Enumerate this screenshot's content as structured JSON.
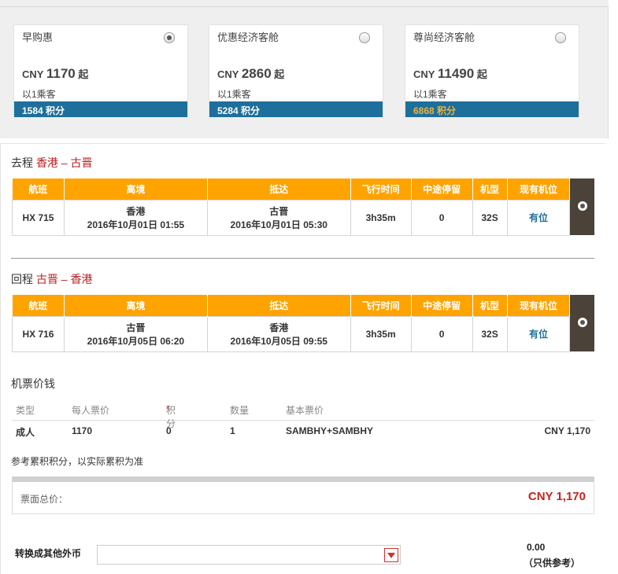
{
  "fares": [
    {
      "name": "早购惠",
      "currency": "CNY",
      "amount": "1170",
      "suffix": "起",
      "pax": "以1乘客",
      "points": "1584 积分",
      "selected": true
    },
    {
      "name": "优惠经济客舱",
      "currency": "CNY",
      "amount": "2860",
      "suffix": "起",
      "pax": "以1乘客",
      "points": "5284 积分",
      "selected": false
    },
    {
      "name": "尊尚经济客舱",
      "currency": "CNY",
      "amount": "11490",
      "suffix": "起",
      "pax": "以1乘客",
      "points": "6868 积分",
      "selected": false
    }
  ],
  "columns": [
    "航班",
    "离境",
    "抵达",
    "飞行时间",
    "中途停留",
    "机型",
    "现有机位"
  ],
  "outbound": {
    "label": "去程",
    "route": "香港 – 古晋",
    "flight": "HX 715",
    "dep_city": "香港",
    "dep_time": "2016年10月01日 01:55",
    "arr_city": "古晋",
    "arr_time": "2016年10月01日 05:30",
    "duration": "3h35m",
    "stops": "0",
    "aircraft": "32S",
    "availability": "有位"
  },
  "inbound": {
    "label": "回程",
    "route": "古晋 – 香港",
    "flight": "HX 716",
    "dep_city": "古晋",
    "dep_time": "2016年10月05日 06:20",
    "arr_city": "香港",
    "arr_time": "2016年10月05日 09:55",
    "duration": "3h35m",
    "stops": "0",
    "aircraft": "32S",
    "availability": "有位"
  },
  "pricing": {
    "title": "机票价钱",
    "headers": {
      "type": "类型",
      "per_person": "每人票价",
      "points": "积分",
      "points_star": "*",
      "qty": "数量",
      "basic": "基本票价"
    },
    "row": {
      "type": "成人",
      "per_person": "1170",
      "points": "0",
      "qty": "1",
      "basic": "SAMBHY+SAMBHY",
      "total": "CNY 1,170"
    },
    "note": "参考累积积分，以实际累积为准",
    "total_label": "票面总价：",
    "total_amount": "CNY 1,170"
  },
  "convert": {
    "label": "转换成其他外币",
    "value": "0.00",
    "note": "（只供参考）"
  },
  "colors": {
    "header_orange": "#ffa300",
    "points_blue": "#1e6f9b",
    "route_red": "#b22222",
    "total_red": "#c8221e"
  }
}
